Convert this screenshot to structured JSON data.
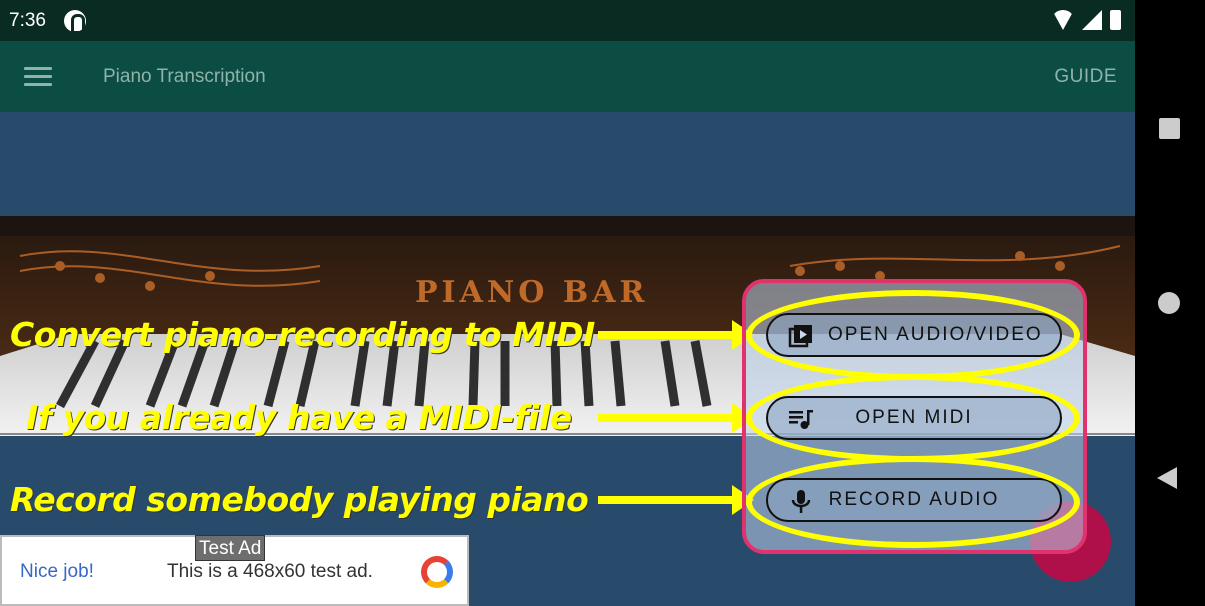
{
  "status_bar": {
    "time": "7:36"
  },
  "app_bar": {
    "title": "Piano Transcription",
    "guide_label": "GUIDE"
  },
  "banner": {
    "text": "PIANO BAR"
  },
  "annotations": {
    "convert": "Convert piano-recording to MIDI",
    "midi": "If you already have a MIDI-file",
    "record": "Record somebody playing piano"
  },
  "actions": {
    "open_audio_video": "OPEN AUDIO/VIDEO",
    "open_midi": "OPEN MIDI",
    "record_audio": "RECORD AUDIO"
  },
  "ad": {
    "tag": "Test Ad",
    "nice": "Nice job!",
    "text": "This is a 468x60 test ad."
  },
  "colors": {
    "accent": "#ffff00",
    "panel_border": "#e0336e",
    "app_bar": "#0b4d43",
    "background": "#284a6b"
  }
}
